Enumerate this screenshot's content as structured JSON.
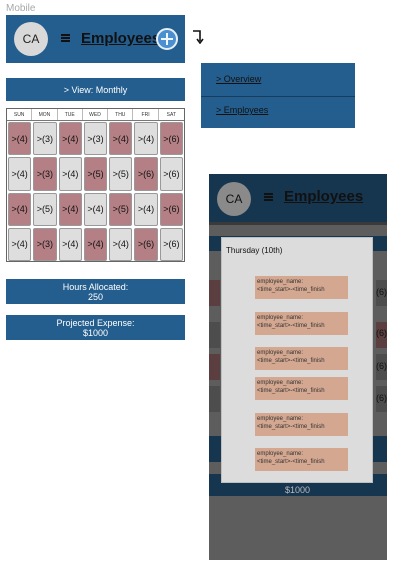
{
  "page_label": "Mobile",
  "header": {
    "avatar_initials": "CA",
    "title": "Employees"
  },
  "view_bar": {
    "label": ">  View: Monthly"
  },
  "calendar": {
    "days": [
      "SUN",
      "MON",
      "TUE",
      "WED",
      "THU",
      "FRI",
      "SAT"
    ],
    "rows": [
      [
        ">(4)",
        ">(3)",
        ">(4)",
        ">(3)",
        ">(4)",
        ">(4)",
        ">(6)"
      ],
      [
        ">(4)",
        ">(3)",
        ">(4)",
        ">(5)",
        ">(5)",
        ">(6)",
        ">(6)"
      ],
      [
        ">(4)",
        ">(5)",
        ">(4)",
        ">(4)",
        ">(5)",
        ">(4)",
        ">(6)"
      ],
      [
        ">(4)",
        ">(3)",
        ">(4)",
        ">(4)",
        ">(4)",
        ">(6)",
        ">(6)"
      ]
    ],
    "colors": {
      "highlight": "#b48085",
      "normal": "#dedede"
    }
  },
  "stats": {
    "hours_label": "Hours Allocated:",
    "hours_value": "250",
    "expense_label": "Projected Expense:",
    "expense_value": "$1000"
  },
  "menu": {
    "items": [
      "> Overview",
      "> Employees"
    ]
  },
  "right_screen": {
    "avatar_initials": "CA",
    "title": "Employees",
    "bg_expense": "$1000",
    "bg_row_values": [
      "(6)",
      "(6)",
      "(6)",
      "(6)"
    ],
    "modal": {
      "title": "Thursday (10th)",
      "shifts": [
        {
          "name": "employee_name:",
          "time": "<time_start>-<time_finish"
        },
        {
          "name": "employee_name:",
          "time": "<time_start>-<time_finish"
        },
        {
          "name": "employee_name:",
          "time": "<time_start>-<time_finish"
        },
        {
          "name": "employee_name:",
          "time": "<time_start>-<time_finish"
        },
        {
          "name": "employee_name:",
          "time": "<time_start>-<time_finish"
        },
        {
          "name": "employee_name:",
          "time": "<time_start>-<time_finish"
        }
      ]
    }
  },
  "theme": {
    "primary": "#245e8e",
    "primary_dark": "#163650",
    "shift": "#d4a791"
  }
}
